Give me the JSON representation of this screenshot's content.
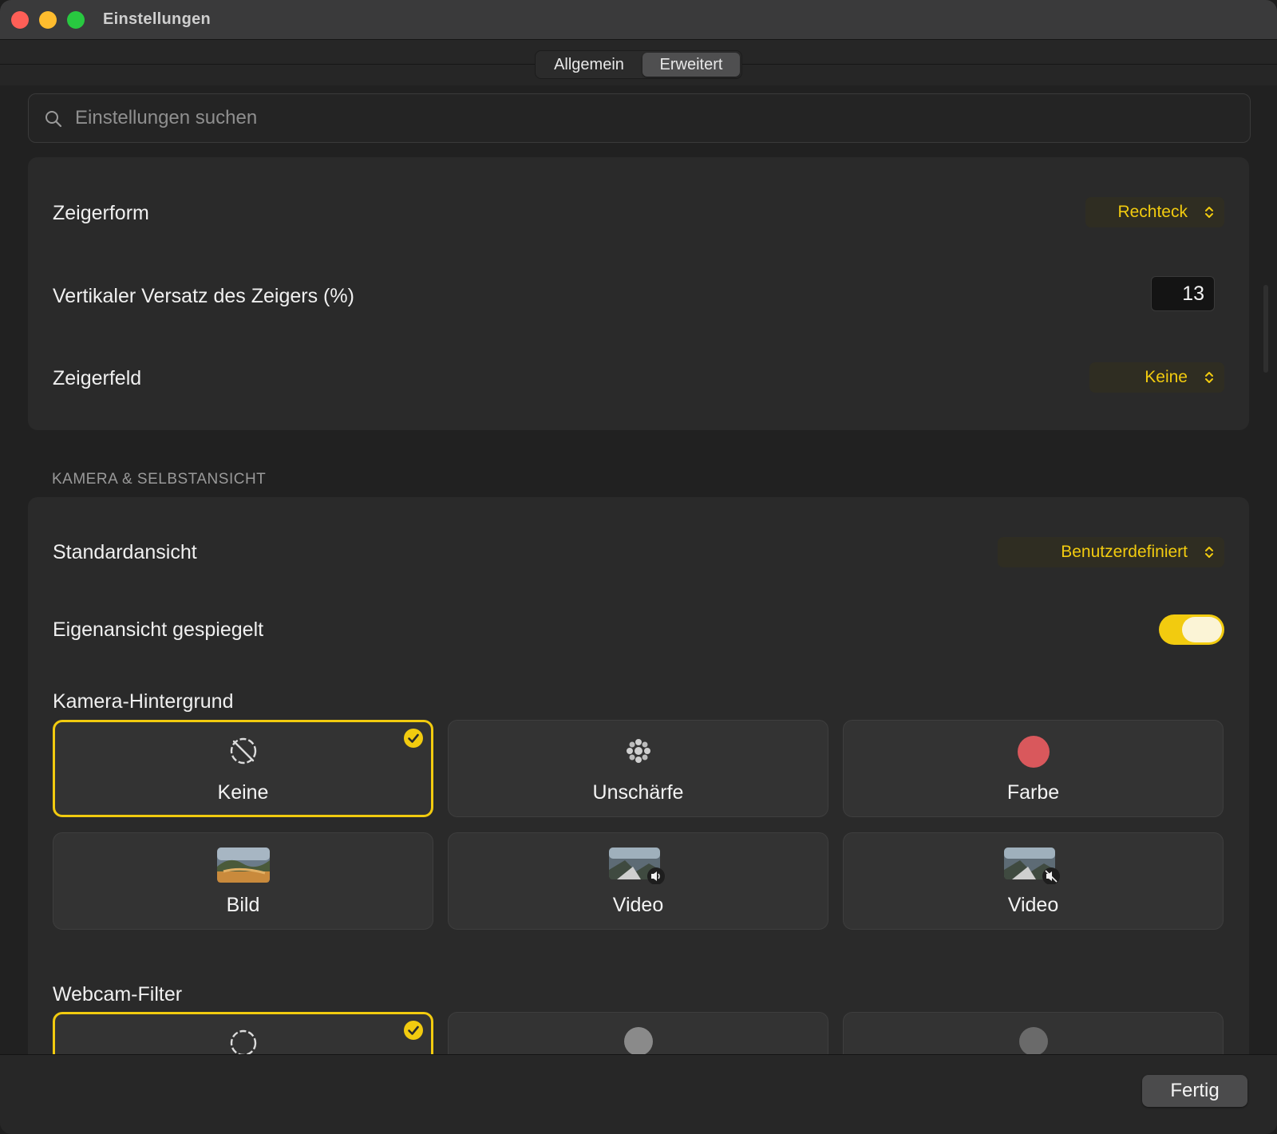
{
  "window": {
    "title": "Einstellungen"
  },
  "tabs": [
    {
      "label": "Allgemein",
      "selected": false
    },
    {
      "label": "Erweitert",
      "selected": true
    }
  ],
  "search": {
    "placeholder": "Einstellungen suchen"
  },
  "pointer_group": {
    "pointer_shape": {
      "label": "Zeigerform",
      "value": "Rechteck"
    },
    "vertical_offset": {
      "label": "Vertikaler Versatz des Zeigers (%)",
      "value": "13"
    },
    "pointer_field": {
      "label": "Zeigerfeld",
      "value": "Keine"
    }
  },
  "camera_section": {
    "header": "KAMERA & SELBSTANSICHT",
    "default_view": {
      "label": "Standardansicht",
      "value": "Benutzerdefiniert"
    },
    "mirrored": {
      "label": "Eigenansicht gespiegelt",
      "on": true
    },
    "background": {
      "label": "Kamera-Hintergrund",
      "options": [
        {
          "label": "Keine",
          "icon": "no-background-icon",
          "selected": true
        },
        {
          "label": "Unschärfe",
          "icon": "blur-icon",
          "selected": false
        },
        {
          "label": "Farbe",
          "icon": "color-swatch-icon",
          "selected": false
        },
        {
          "label": "Bild",
          "icon": "image-thumbnail-icon",
          "selected": false
        },
        {
          "label": "Video",
          "icon": "video-sound-icon",
          "selected": false
        },
        {
          "label": "Video",
          "icon": "video-muted-icon",
          "selected": false
        }
      ]
    },
    "webcam_filter": {
      "label": "Webcam-Filter"
    }
  },
  "footer": {
    "done_label": "Fertig"
  },
  "colors": {
    "accent": "#f2cb0f",
    "swatch": "#d9585c"
  }
}
